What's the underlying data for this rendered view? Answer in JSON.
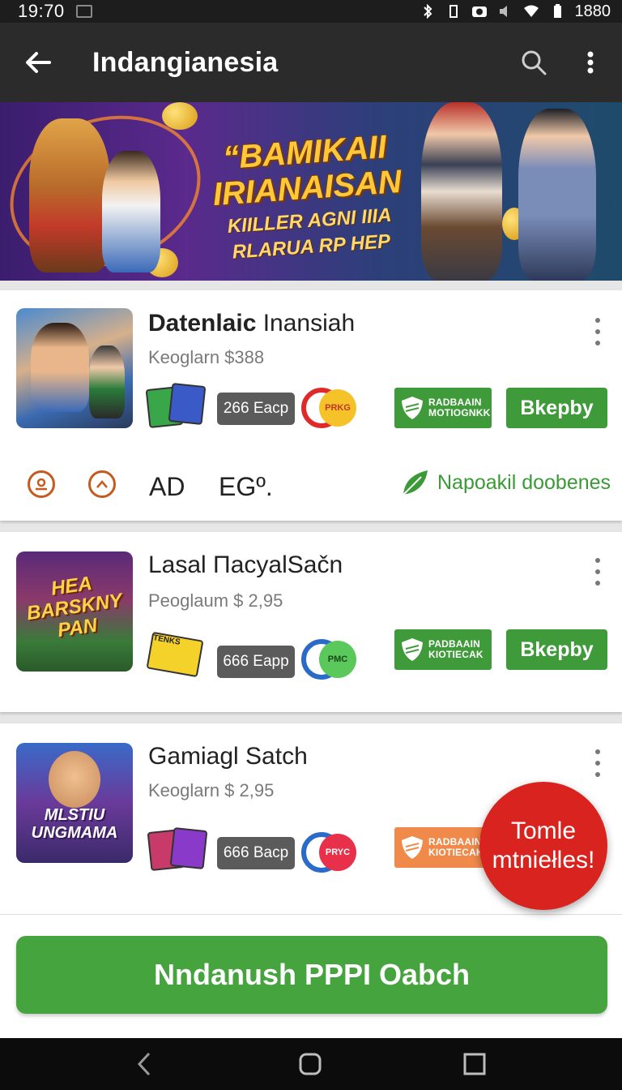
{
  "status_bar": {
    "time": "19:70",
    "battery": "1880"
  },
  "app_bar": {
    "title": "Indangianesia"
  },
  "banner": {
    "headline_line1": "“BAMIKAII",
    "headline_line2": "IRIANAISAN",
    "sub_line1": "KIILLER AGNI IIIA",
    "sub_line2": "RLARUA RP HEP"
  },
  "apps": [
    {
      "name_bold": "Datenlaic",
      "name_rest": " Inansiah",
      "sub": "Keoglarn $388",
      "size": "266 Eacp",
      "ring_text": "PRKG",
      "badge_line1": "RADBAAIN",
      "badge_line2": "MOTIOGNKK",
      "action": "Bkepby"
    },
    {
      "name": "Lasal ΠacyalSačn",
      "sub": "Peoglaum $ 2,95",
      "thumb_caption_1": "HEA",
      "thumb_caption_2": "BARSKNY",
      "thumb_caption_3": "PAN",
      "sticker_text": "TENKS",
      "size": "666 Eapp",
      "ring_text": "PMC",
      "badge_line1": "PADBAAIN",
      "badge_line2": "KIOTIECAK",
      "action": "Bkepby"
    },
    {
      "name": "Gamiagl Satch",
      "sub": "Keoglarn $ 2,95",
      "thumb_caption_1": "MLSTIU",
      "thumb_caption_2": "UNGMAMA",
      "size": "666 Bacp",
      "ring_text": "PRYC",
      "badge_line1": "RADBAAIN",
      "badge_line2": "KIOTIECAK"
    }
  ],
  "meta_row": {
    "label_ad": "AD",
    "label_eg": "EGº.",
    "link": "Napoakil doobenes"
  },
  "fab": {
    "line1": "Tomle",
    "line2": "mtniełles!"
  },
  "cta": {
    "label": "Nndanush PPPI Oabch"
  },
  "colors": {
    "accent_green": "#3f9a3a",
    "fab_red": "#d8231f",
    "badge_orange": "#f08a4a",
    "app_bar": "#2b2b2b"
  },
  "icons": [
    "back-arrow-icon",
    "search-icon",
    "more-vert-icon",
    "shield-icon",
    "leaf-icon",
    "back-nav-icon",
    "home-nav-icon",
    "recents-nav-icon"
  ]
}
